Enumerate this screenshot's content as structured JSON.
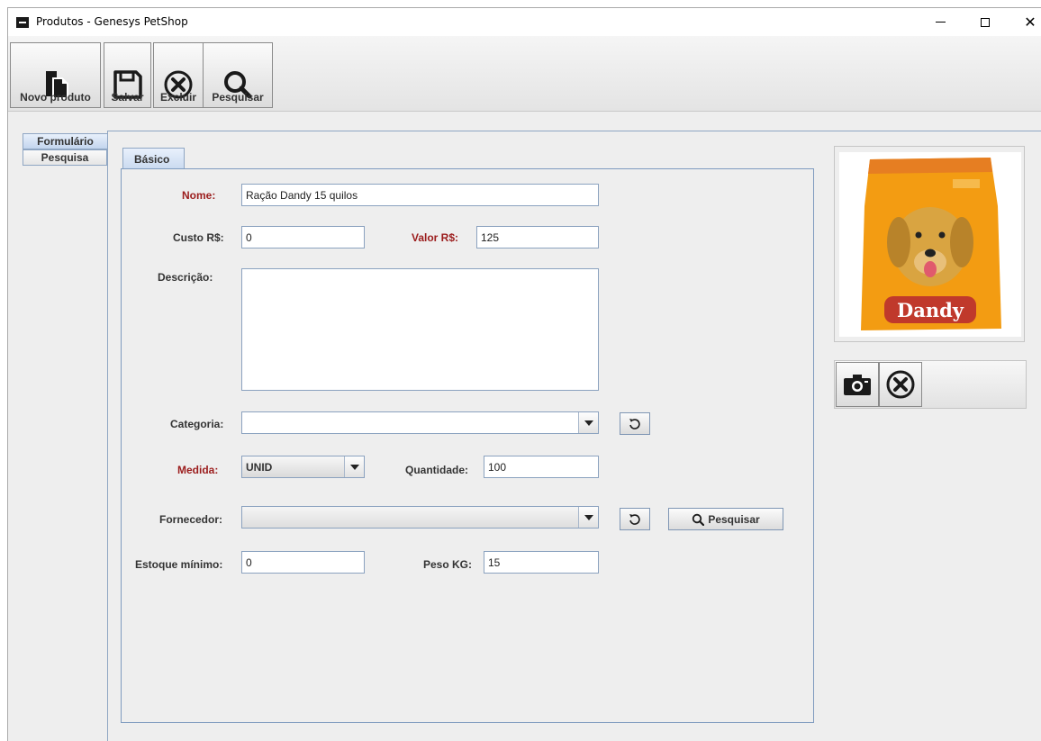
{
  "window": {
    "title": "Produtos - Genesys PetShop",
    "minimize": "—",
    "close": "✕"
  },
  "toolbar": {
    "novo_label": "Novo produto",
    "salvar_label": "Salvar",
    "excluir_label": "Excluir",
    "pesquisar_label": "Pesquisar"
  },
  "side_tabs": {
    "formulario": "Formulário",
    "pesquisa": "Pesquisa"
  },
  "form": {
    "tab": "Básico",
    "nome_label": "Nome:",
    "nome_value": "Ração Dandy 15 quilos",
    "custo_label": "Custo R$:",
    "custo_value": "0",
    "valor_label": "Valor R$:",
    "valor_value": "125",
    "descricao_label": "Descrição:",
    "descricao_value": "",
    "categoria_label": "Categoria:",
    "categoria_value": "",
    "medida_label": "Medida:",
    "medida_value": "UNID",
    "quantidade_label": "Quantidade:",
    "quantidade_value": "100",
    "fornecedor_label": "Fornecedor:",
    "fornecedor_value": "",
    "pesquisar_fornecedor_label": "Pesquisar",
    "estoque_label": "Estoque mínimo:",
    "estoque_value": "0",
    "peso_label": "Peso KG:",
    "peso_value": "15"
  },
  "product_image": {
    "brand_text": "Dandy",
    "bag_color": "#f39c12",
    "label_color": "#c0392b"
  },
  "colors": {
    "required_label": "#9b1c1c",
    "panel_border": "#7f9bbf"
  }
}
